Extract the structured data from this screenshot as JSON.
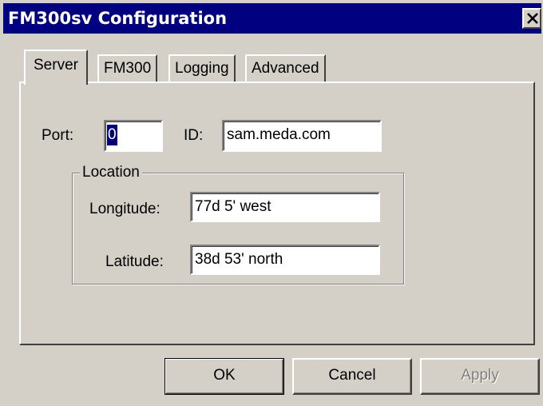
{
  "window": {
    "title": "FM300sv Configuration"
  },
  "tabs": [
    {
      "label": "Server",
      "selected": true
    },
    {
      "label": "FM300",
      "selected": false
    },
    {
      "label": "Logging",
      "selected": false
    },
    {
      "label": "Advanced",
      "selected": false
    }
  ],
  "server": {
    "port_label": "Port:",
    "port_value": "0",
    "id_label": "ID:",
    "id_value": "sam.meda.com",
    "location": {
      "group_label": "Location",
      "longitude_label": "Longitude:",
      "longitude_value": "77d 5' west",
      "latitude_label": "Latitude:",
      "latitude_value": "38d 53' north"
    }
  },
  "buttons": {
    "ok_label": "OK",
    "cancel_label": "Cancel",
    "apply_label": "Apply",
    "apply_enabled": false
  },
  "icons": {
    "close": "close-icon"
  },
  "colors": {
    "titlebar": "#000080",
    "face": "#d4d0c8",
    "field_bg": "#ffffff",
    "selection": "#000080"
  }
}
